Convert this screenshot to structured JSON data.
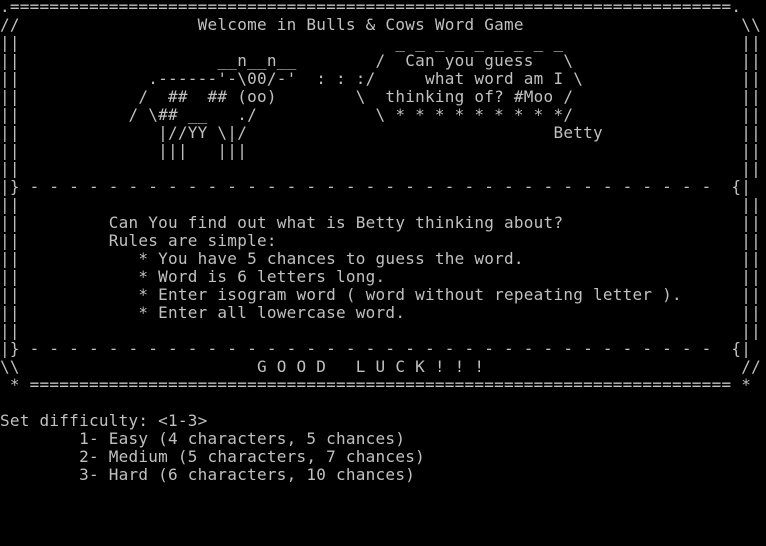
{
  "window": {
    "title": "Welcome in Bulls & Cows Word Game"
  },
  "colors": {
    "background": "#000000",
    "text": "#c0c0c0"
  },
  "banner": {
    "lines": [
      ".=========================================================================.",
      "//                  Welcome in Bulls & Cows Word Game                      \\\\",
      "||                                      _ _ _ _ _ _ _ _ _                  ||",
      "||                    __n__n__        /  Can you guess   \\                 ||",
      "||             .------'-\\00/-'  : : :/     what word am I \\                ||",
      "||            /  ##  ## (oo)        \\  thinking of? #Moo /                 ||",
      "||           / \\## __   ./            \\ * * * * * * * * */                 ||",
      "||              |//YY \\|/                               Betty              ||",
      "||              |||   |||                                                  ||",
      "||                                                                         ||",
      "|} - - - - - - - - - - - - - - - - - - - - - - - - - - - - - - - - - - -  {|",
      "||                                                                         ||",
      "||         Can You find out what is Betty thinking about?                  ||",
      "||         Rules are simple:                                               ||",
      "||            * You have 5 chances to guess the word.                      ||",
      "||            * Word is 6 letters long.                                    ||",
      "||            * Enter isogram word ( word without repeating letter ).      ||",
      "||            * Enter all lowercase word.                                  ||",
      "||                                                                         ||",
      "|} - - - - - - - - - - - - - - - - - - - - - - - - - - - - - - - - - - -  {|",
      "\\\\                        G O O D   L U C K ! ! !                          //",
      " * ======================================================================= *"
    ]
  },
  "prompt": {
    "label": "Set difficulty: <1-3>",
    "options": [
      "        1- Easy (4 characters, 5 chances)",
      "        2- Medium (5 characters, 7 chances)",
      "        3- Hard (6 characters, 10 chances)"
    ]
  }
}
